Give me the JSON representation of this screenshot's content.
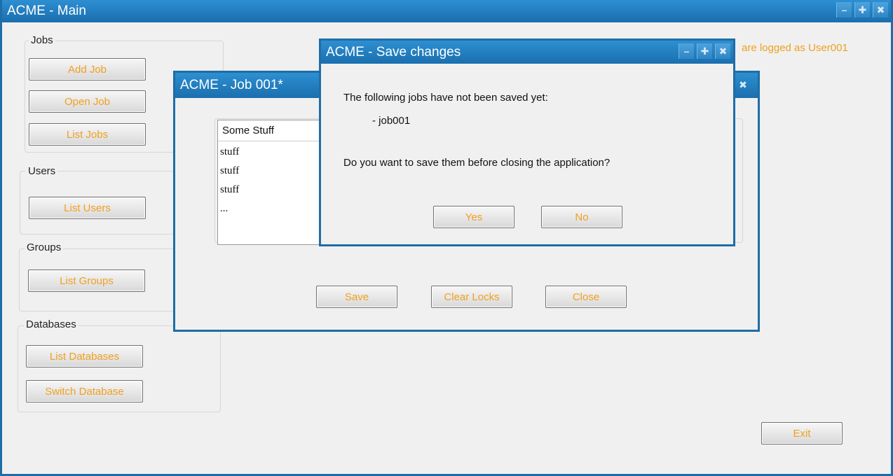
{
  "main_window": {
    "title": "ACME - Main",
    "logged_as": "are logged as User001",
    "exit_label": "Exit",
    "controls": {
      "minimize": "–",
      "maximize": "✚",
      "close": "✖"
    }
  },
  "sidebar": {
    "jobs": {
      "label": "Jobs",
      "buttons": [
        "Add Job",
        "Open Job",
        "List Jobs"
      ]
    },
    "users": {
      "label": "Users",
      "buttons": [
        "List Users"
      ]
    },
    "groups": {
      "label": "Groups",
      "buttons": [
        "List Groups"
      ]
    },
    "databases": {
      "label": "Databases",
      "buttons": [
        "List Databases",
        "Switch Database"
      ]
    }
  },
  "job_window": {
    "title": "ACME - Job 001*",
    "list": {
      "header": "Some Stuff",
      "items": [
        "stuff",
        "stuff",
        "stuff",
        "..."
      ]
    },
    "buttons": {
      "save": "Save",
      "clear_locks": "Clear Locks",
      "close": "Close"
    },
    "close_glyph": "✖"
  },
  "save_dialog": {
    "title": "ACME - Save changes",
    "line1": "The following jobs have not been saved yet:",
    "job_item": "- job001",
    "question": "Do you want to save them before closing the application?",
    "yes_label": "Yes",
    "no_label": "No",
    "controls": {
      "minimize": "–",
      "maximize": "✚",
      "close": "✖"
    }
  },
  "colors": {
    "title_bar": "#1a6fae",
    "window_border": "#1f6da6",
    "button_text": "#f0a020",
    "background": "#f0f0f0"
  }
}
